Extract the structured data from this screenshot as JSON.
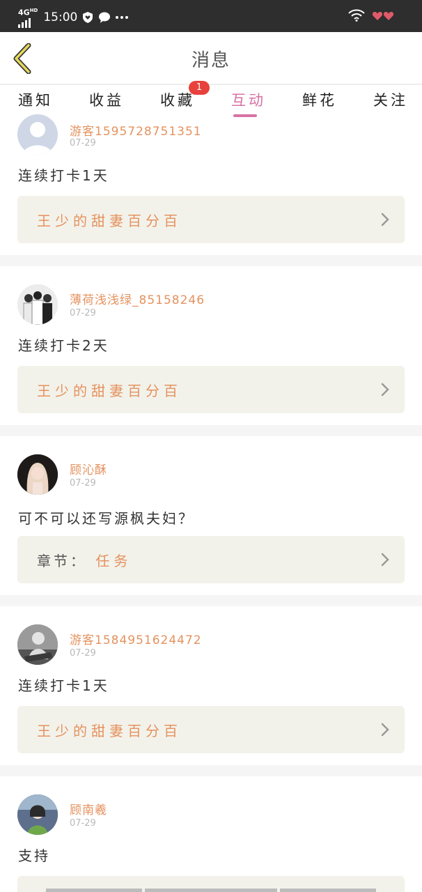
{
  "status_bar": {
    "network": "4G",
    "network_sup": "HD",
    "time": "15:00",
    "icons": [
      "signal-icon",
      "shield-heart-icon",
      "chat-bubble-icon",
      "more-dots-icon",
      "wifi-icon",
      "hearts-icon"
    ]
  },
  "header": {
    "title": "消息",
    "back_icon": "chevron-left-icon"
  },
  "tabs": [
    {
      "label": "通知",
      "active": false
    },
    {
      "label": "收益",
      "active": false
    },
    {
      "label": "收藏",
      "active": false,
      "badge": "1"
    },
    {
      "label": "互动",
      "active": true
    },
    {
      "label": "鲜花",
      "active": false
    },
    {
      "label": "关注",
      "active": false
    }
  ],
  "colors": {
    "accent": "#d872a6",
    "username": "#e4925f",
    "badge": "#e8413c",
    "ref_bg": "#f3f2ea"
  },
  "feed": [
    {
      "username": "游客1595728751351",
      "date": "07-29",
      "message": "连续打卡1天",
      "ref_label": "",
      "ref_text": "王少的甜妻百分百",
      "avatar": "default-avatar-icon"
    },
    {
      "username": "薄荷浅浅绿_85158246",
      "date": "07-29",
      "message": "连续打卡2天",
      "ref_label": "",
      "ref_text": "王少的甜妻百分百",
      "avatar": "group-photo-avatar"
    },
    {
      "username": "顾沁酥",
      "date": "07-29",
      "message": "可不可以还写源枫夫妇？",
      "ref_label": "章节：",
      "ref_text": "任务",
      "avatar": "girl-photo-avatar"
    },
    {
      "username": "游客1584951624472",
      "date": "07-29",
      "message": "连续打卡1天",
      "ref_label": "",
      "ref_text": "王少的甜妻百分百",
      "avatar": "person-photo-avatar"
    },
    {
      "username": "顾南羲",
      "date": "07-29",
      "message": "支持",
      "ref_label": "",
      "ref_text": "",
      "avatar": "girl-photo-avatar"
    }
  ]
}
